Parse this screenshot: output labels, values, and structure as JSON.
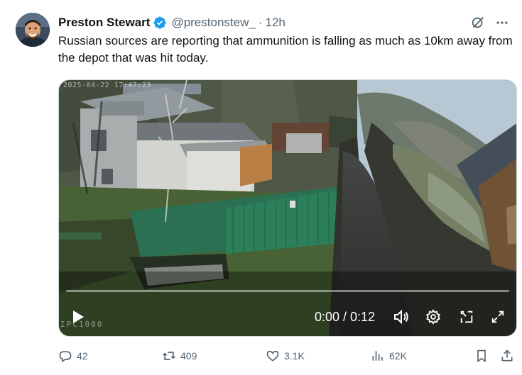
{
  "author": {
    "name": "Preston Stewart",
    "handle": "@prestonstew_",
    "separator": "·",
    "time": "12h",
    "verified": true
  },
  "tweet": {
    "text": "Russian sources are reporting that ammunition is falling as much as 10km away from the depot that was hit today."
  },
  "video": {
    "overlay_timestamp": "2025-04-22 17:47:23",
    "overlay_watermark": "IPC1000",
    "time_display": "0:00 / 0:12",
    "progress_fraction": 0.0
  },
  "actions": {
    "replies": "42",
    "reposts": "409",
    "likes": "3.1K",
    "views": "62K"
  },
  "icons": {
    "verified": "verified-badge-icon",
    "grok": "grok-icon",
    "more": "more-icon",
    "play": "play-icon",
    "volume": "volume-icon",
    "settings": "gear-icon",
    "pip": "picture-in-picture-icon",
    "fullscreen": "fullscreen-icon",
    "reply": "reply-icon",
    "repost": "repost-icon",
    "like": "heart-icon",
    "views": "views-icon",
    "bookmark": "bookmark-icon",
    "share": "share-icon"
  },
  "colors": {
    "text": "#0f1419",
    "secondary": "#536471",
    "verified": "#1d9bf0"
  }
}
